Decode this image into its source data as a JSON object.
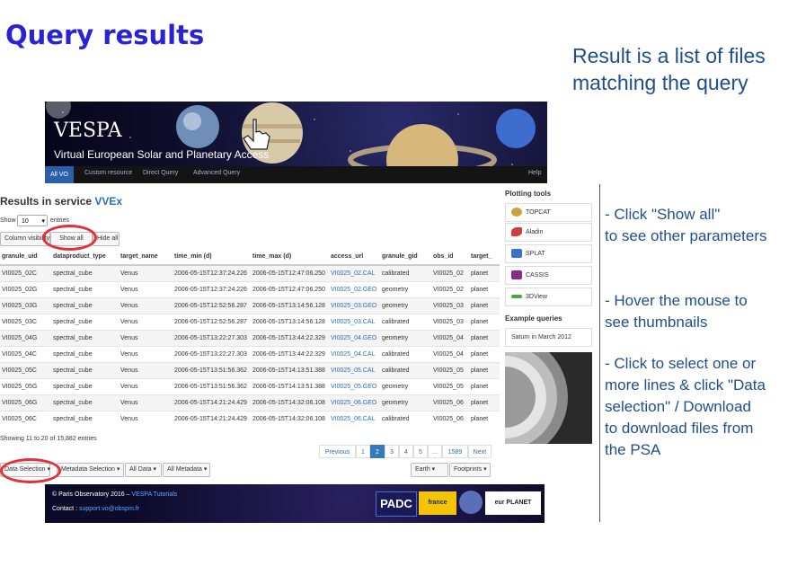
{
  "slide_title": "Query results",
  "top_note": [
    "Result is a list of files",
    "matching the query"
  ],
  "banner": {
    "title": "VESPA",
    "subtitle": "Virtual European Solar and Planetary Access",
    "nav": [
      "All VO",
      "Custom resource",
      "Direct Query",
      "Advanced Query",
      "Help"
    ]
  },
  "results": {
    "title_prefix": "Results in service ",
    "service": "VVEx",
    "show_label": "Show",
    "entries_value": "10",
    "entries_label": "entries",
    "column_visibility": "Column visibility",
    "show_all": "Show all",
    "hide_all": "Hide all",
    "columns": [
      "granule_uid",
      "dataproduct_type",
      "target_name",
      "time_min (d)",
      "time_max (d)",
      "access_url",
      "granule_gid",
      "obs_id",
      "target_"
    ],
    "rows": [
      [
        "VI0025_02C",
        "spectral_cube",
        "Venus",
        "2006-05-15T12:37:24.226",
        "2006-05-15T12:47:06.250",
        "VI0025_02.CAL",
        "calibrated",
        "VI0025_02",
        "planet"
      ],
      [
        "VI0025_02G",
        "spectral_cube",
        "Venus",
        "2006-05-15T12:37:24.226",
        "2006-05-15T12:47:06.250",
        "VI0025_02.GEO",
        "geometry",
        "VI0025_02",
        "planet"
      ],
      [
        "VI0025_03G",
        "spectral_cube",
        "Venus",
        "2006-05-15T12:52:56.287",
        "2006-05-15T13:14:56.128",
        "VI0025_03.GEO",
        "geometry",
        "VI0025_03",
        "planet"
      ],
      [
        "VI0025_03C",
        "spectral_cube",
        "Venus",
        "2006-05-15T12:52:56.287",
        "2006-05-15T13:14:56.128",
        "VI0025_03.CAL",
        "calibrated",
        "VI0025_03",
        "planet"
      ],
      [
        "VI0025_04G",
        "spectral_cube",
        "Venus",
        "2006-05-15T13:22:27.303",
        "2006-05-15T13:44:22.329",
        "VI0025_04.GEO",
        "geometry",
        "VI0025_04",
        "planet"
      ],
      [
        "VI0025_04C",
        "spectral_cube",
        "Venus",
        "2006-05-15T13:22:27.303",
        "2006-05-15T13:44:22.329",
        "VI0025_04.CAL",
        "calibrated",
        "VI0025_04",
        "planet"
      ],
      [
        "VI0025_05C",
        "spectral_cube",
        "Venus",
        "2006-05-15T13:51:56.362",
        "2006-05-15T14:13:51.388",
        "VI0025_05.CAL",
        "calibrated",
        "VI0025_05",
        "planet"
      ],
      [
        "VI0025_05G",
        "spectral_cube",
        "Venus",
        "2006-05-15T13:51:56.362",
        "2006-05-15T14:13:51.388",
        "VI0025_05.GEO",
        "geometry",
        "VI0025_05",
        "planet"
      ],
      [
        "VI0025_06G",
        "spectral_cube",
        "Venus",
        "2006-05-15T14:21:24.429",
        "2006-05-15T14:32:06.108",
        "VI0025_06.GEO",
        "geometry",
        "VI0025_06",
        "planet"
      ],
      [
        "VI0025_06C",
        "spectral_cube",
        "Venus",
        "2006-05-15T14:21:24.429",
        "2006-05-15T14:32:06.108",
        "VI0025_06.CAL",
        "calibrated",
        "VI0025_06",
        "planet"
      ]
    ],
    "summary": "Showing 11 to 20 of 15,882 entries",
    "pagination": [
      "Previous",
      "1",
      "2",
      "3",
      "4",
      "5",
      "...",
      "1589",
      "Next"
    ],
    "current_page": "2",
    "buttons": {
      "data_selection": "Data Selection",
      "metadata_selection": "Metadata Selection",
      "all_data": "All Data",
      "all_metadata": "All Metadata",
      "earth": "Earth",
      "footprints": "Footprints"
    }
  },
  "footer": {
    "line1_prefix": "© Paris Observatory 2016 – ",
    "line1_link": "VESPA Tutorials",
    "line2_prefix": "Contact : ",
    "line2_link": "support.vo@obspm.fr",
    "logos": [
      "PADC",
      "france",
      "eur PLANET"
    ]
  },
  "right_panel": {
    "plotting_title": "Plotting tools",
    "tools": [
      "TOPCAT",
      "Aladin",
      "SPLAT",
      "CASSIS",
      "3DView"
    ],
    "example_title": "Example queries",
    "example_query": "Saturn in March 2012"
  },
  "notes": [
    [
      "- Click \"Show all\"",
      "to see other parameters"
    ],
    [
      "- Hover the mouse to",
      "see thumbnails"
    ],
    [
      "- Click to select one or",
      "more lines & click \"Data",
      "selection\" / Download",
      "to download files from",
      "the PSA"
    ]
  ],
  "colors": {
    "title": "#2a22d6",
    "notes": "#1f4e8c",
    "highlight": "#e2303a",
    "link": "#2a6db0",
    "nav_active": "#2b5fa8"
  }
}
